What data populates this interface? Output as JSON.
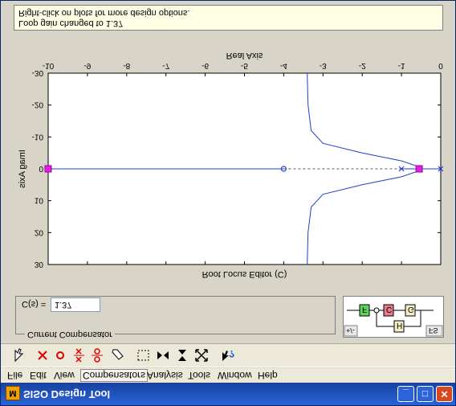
{
  "window": {
    "title": "SISO Design Tool",
    "min_glyph": "_",
    "max_glyph": "□",
    "close_glyph": "✕"
  },
  "menu": [
    "File",
    "Edit",
    "View",
    "Compensators",
    "Analysis",
    "Tools",
    "Window",
    "Help"
  ],
  "toolbar_icons": [
    "pointer-icon",
    "add-real-pole-icon",
    "add-real-zero-icon",
    "add-complex-pole-icon",
    "add-complex-zero-icon",
    "eraser-icon",
    "zoom-box-icon",
    "zoom-x-icon",
    "zoom-y-icon",
    "fit-icon",
    "whats-this-icon"
  ],
  "compensator": {
    "group_title": "Current Compensator",
    "label": "C(s) =",
    "value": "1.37"
  },
  "architecture": {
    "toggle": "+/-",
    "fs": "FS",
    "blocks": [
      "F",
      "C",
      "G",
      "H"
    ]
  },
  "chart_data": {
    "type": "line",
    "title": "Root Locus Editor (C)",
    "xlabel": "Real Axis",
    "ylabel": "Imag Axis",
    "xlim": [
      -10,
      0
    ],
    "ylim": [
      -30,
      30
    ],
    "xticks": [
      "-10",
      "-9",
      "-8",
      "-7",
      "-6",
      "-5",
      "-4",
      "-3",
      "-2",
      "-1",
      "0"
    ],
    "yticks": [
      "30",
      "20",
      "10",
      "0",
      "-10",
      "-20",
      "-30"
    ],
    "grid": false,
    "series": [
      {
        "values": [
          [
            -3.4,
            30
          ],
          [
            -3.38,
            20
          ],
          [
            -3.3,
            12
          ],
          [
            -3.0,
            8
          ],
          [
            -2.0,
            5
          ],
          [
            -1.0,
            2.5
          ],
          [
            -0.6,
            0.8
          ],
          [
            -0.55,
            0
          ]
        ]
      },
      {
        "values": [
          [
            -3.4,
            -30
          ],
          [
            -3.38,
            -20
          ],
          [
            -3.3,
            -12
          ],
          [
            -3.0,
            -8
          ],
          [
            -2.0,
            -5
          ],
          [
            -1.0,
            -2.5
          ],
          [
            -0.6,
            -0.8
          ],
          [
            -0.55,
            0
          ]
        ]
      }
    ],
    "poles": [
      -1.0,
      0.0
    ],
    "zeros": [
      -4.0
    ],
    "closed_loop_poles": [
      -10.0,
      -0.55
    ]
  },
  "status": {
    "line1": "Loop gain changed to 1.37",
    "line2": "Right-click on plots for more design options."
  }
}
